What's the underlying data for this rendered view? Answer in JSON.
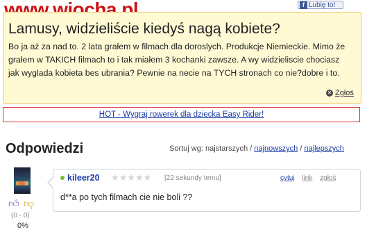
{
  "header": {
    "logo": "www.wiocha.pl",
    "fb_like": {
      "icon": "f",
      "label": "Lubię to!"
    }
  },
  "question": {
    "title": "Lamusy, widzieliście kiedyś nagą kobiete?",
    "body": "Bo ja aż za nad to. 2 lata grałem w filmach dla doroslych. Produkcje Niemieckie. Mimo że grałem w TAKICH filmach to i tak miałem 3 kochanki zawsze. A wy widzieliscie chociasz jak wyglada kobieta bes ubrania? Pewnie na necie na TYCH stronach co nie?dobre i to.",
    "report_label": "Zgłoś"
  },
  "ad": {
    "text": "HOT - Wygraj rowerek dla dziecka Easy Rider!"
  },
  "answers": {
    "title": "Odpowiedzi",
    "sort_label": "Sortuj wg: najstarszych /",
    "sort_newest": "najnowszych",
    "sort_sep": "/",
    "sort_best": "najlepszych"
  },
  "answer": {
    "user": "kileer20",
    "stars": "★★★★★",
    "time": "[22 sekundy temu]",
    "actions": {
      "quote": "cytuj",
      "link": "link",
      "report": "zgłoś"
    },
    "text": "d**a po tych filmach cie nie boli ??",
    "votes": "(0 - 0)",
    "percent": "0%"
  },
  "colors": {
    "question_bg": "#fff9d4",
    "question_border": "#f0c46d",
    "link": "#1a3ea8",
    "ad_border": "#dd3333",
    "online": "#6cbe2b"
  },
  "icons": [
    "facebook-icon",
    "report-icon",
    "thumb-up-icon",
    "thumb-down-icon",
    "online-status-icon",
    "star-rating-icon"
  ]
}
